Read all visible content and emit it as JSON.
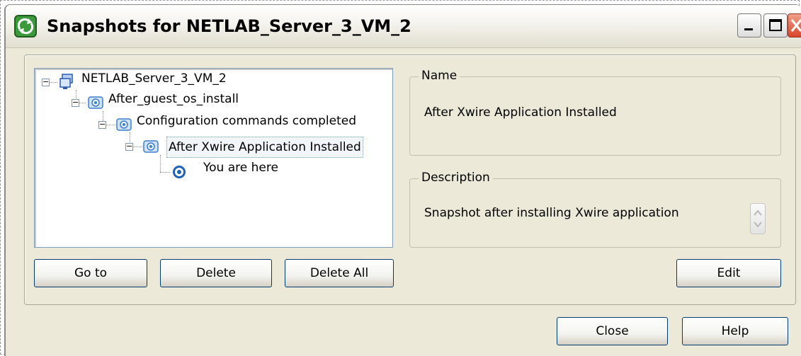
{
  "window": {
    "title": "Snapshots for NETLAB_Server_3_VM_2"
  },
  "tree": {
    "root": "NETLAB_Server_3_VM_2",
    "level1": "After_guest_os_install",
    "level2": "Configuration commands completed",
    "level3": "After Xwire Application Installed",
    "here": "You are here"
  },
  "name_group": {
    "legend": "Name",
    "value": "After Xwire Application Installed"
  },
  "description_group": {
    "legend": "Description",
    "value": "Snapshot after installing Xwire application"
  },
  "buttons": {
    "goto": "Go to",
    "delete": "Delete",
    "delete_all": "Delete All",
    "edit": "Edit",
    "close": "Close",
    "help": "Help"
  }
}
